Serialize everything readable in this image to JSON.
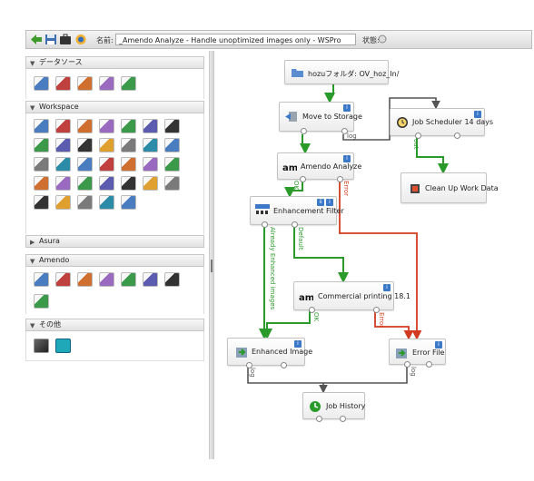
{
  "toolbar": {
    "name_label": "名前:",
    "name_value": "_Amendo Analyze - Handle unoptimized images only - WSPro",
    "status_label": "状態:",
    "icons": [
      "back-arrow-icon",
      "save-icon",
      "briefcase-icon",
      "info-icon"
    ]
  },
  "sidebar": {
    "sections": [
      {
        "title": "データソース",
        "icon_count": 5
      },
      {
        "title": "Workspace",
        "icon_count": 33
      },
      {
        "title": "Asura",
        "icon_count": 0
      },
      {
        "title": "Amendo",
        "icon_count": 8
      },
      {
        "title": "その他",
        "icon_count": 2
      }
    ]
  },
  "workflow": {
    "nodes": {
      "hozu": "hozuフォルダ: OV_hoz_In/",
      "move": "Move to Storage",
      "scheduler": "Job Scheduler 14 days",
      "amendo": "Amendo Analyze",
      "cleanup": "Clean Up Work Data",
      "filter": "Enhancement Filter",
      "commercial": "Commercial printing 18.1",
      "enhanced": "Enhanced Image",
      "error_file": "Error File",
      "history": "Job History"
    },
    "connectors": {
      "log1": "log",
      "out": "out",
      "ok1": "OK",
      "error1": "Error",
      "default": "Default",
      "already": "Already Enhanced images",
      "ok2": "OK",
      "error2": "Error",
      "log2": "log",
      "log3": "log"
    },
    "colors": {
      "ok": "#2a9a2a",
      "error": "#d23b1f",
      "default": "#555555",
      "log": "#555555"
    }
  }
}
